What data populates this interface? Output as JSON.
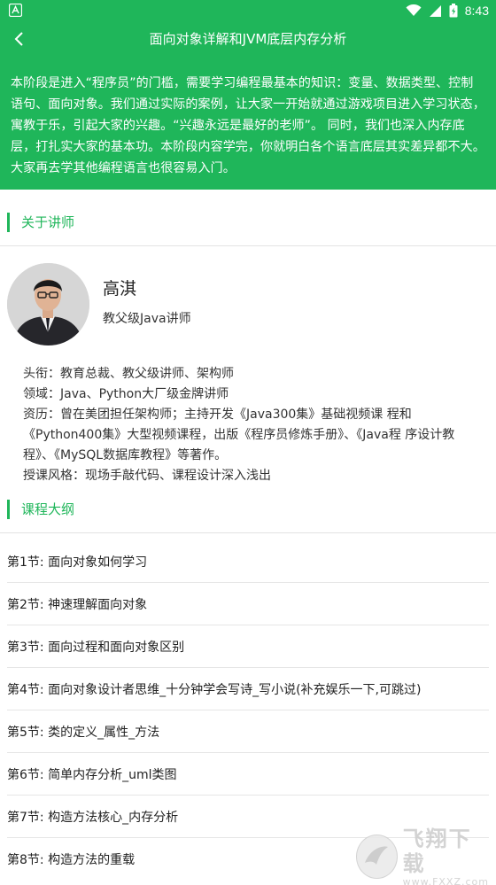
{
  "status_bar": {
    "time": "8:43",
    "icons": [
      "app-icon",
      "wifi-icon",
      "signal-icon",
      "battery-icon"
    ]
  },
  "app_bar": {
    "title": "面向对象详解和JVM底层内存分析",
    "back_icon": "chevron-left-icon"
  },
  "intro": {
    "text": "本阶段是进入“程序员”的门槛，需要学习编程最基本的知识：变量、数据类型、控制语句、面向对象。我们通过实际的案例，让大家一开始就通过游戏项目进入学习状态，寓教于乐，引起大家的兴趣。“兴趣永远是最好的老师”。 同时，我们也深入内存底层，打扎实大家的基本功。本阶段内容学完，你就明白各个语言底层其实差异都不大。大家再去学其他编程语言也很容易入门。"
  },
  "about": {
    "header": "关于讲师",
    "name": "高淇",
    "title": "教父级Java讲师",
    "bio": [
      "头衔：教育总裁、教父级讲师、架构师",
      "领域：Java、Python大厂级金牌讲师",
      "资历：曾在美团担任架构师；主持开发《Java300集》基础视频课 程和《Python400集》大型视频课程，出版《程序员修炼手册》、《Java程 序设计教程》、《MySQL数据库教程》等著作。",
      "授课风格：现场手敲代码、课程设计深入浅出"
    ]
  },
  "outline": {
    "header": "课程大纲",
    "items": [
      "第1节: 面向对象如何学习",
      "第2节: 神速理解面向对象",
      "第3节: 面向过程和面向对象区别",
      "第4节: 面向对象设计者思维_十分钟学会写诗_写小说(补充娱乐一下,可跳过)",
      "第5节: 类的定义_属性_方法",
      "第6节: 简单内存分析_uml类图",
      "第7节: 构造方法核心_内存分析",
      "第8节: 构造方法的重载"
    ]
  },
  "watermark": {
    "name": "飞翔下载",
    "url": "www.FXXZ.com"
  },
  "colors": {
    "accent": "#1fb65a",
    "divider": "#e3e3e3"
  }
}
